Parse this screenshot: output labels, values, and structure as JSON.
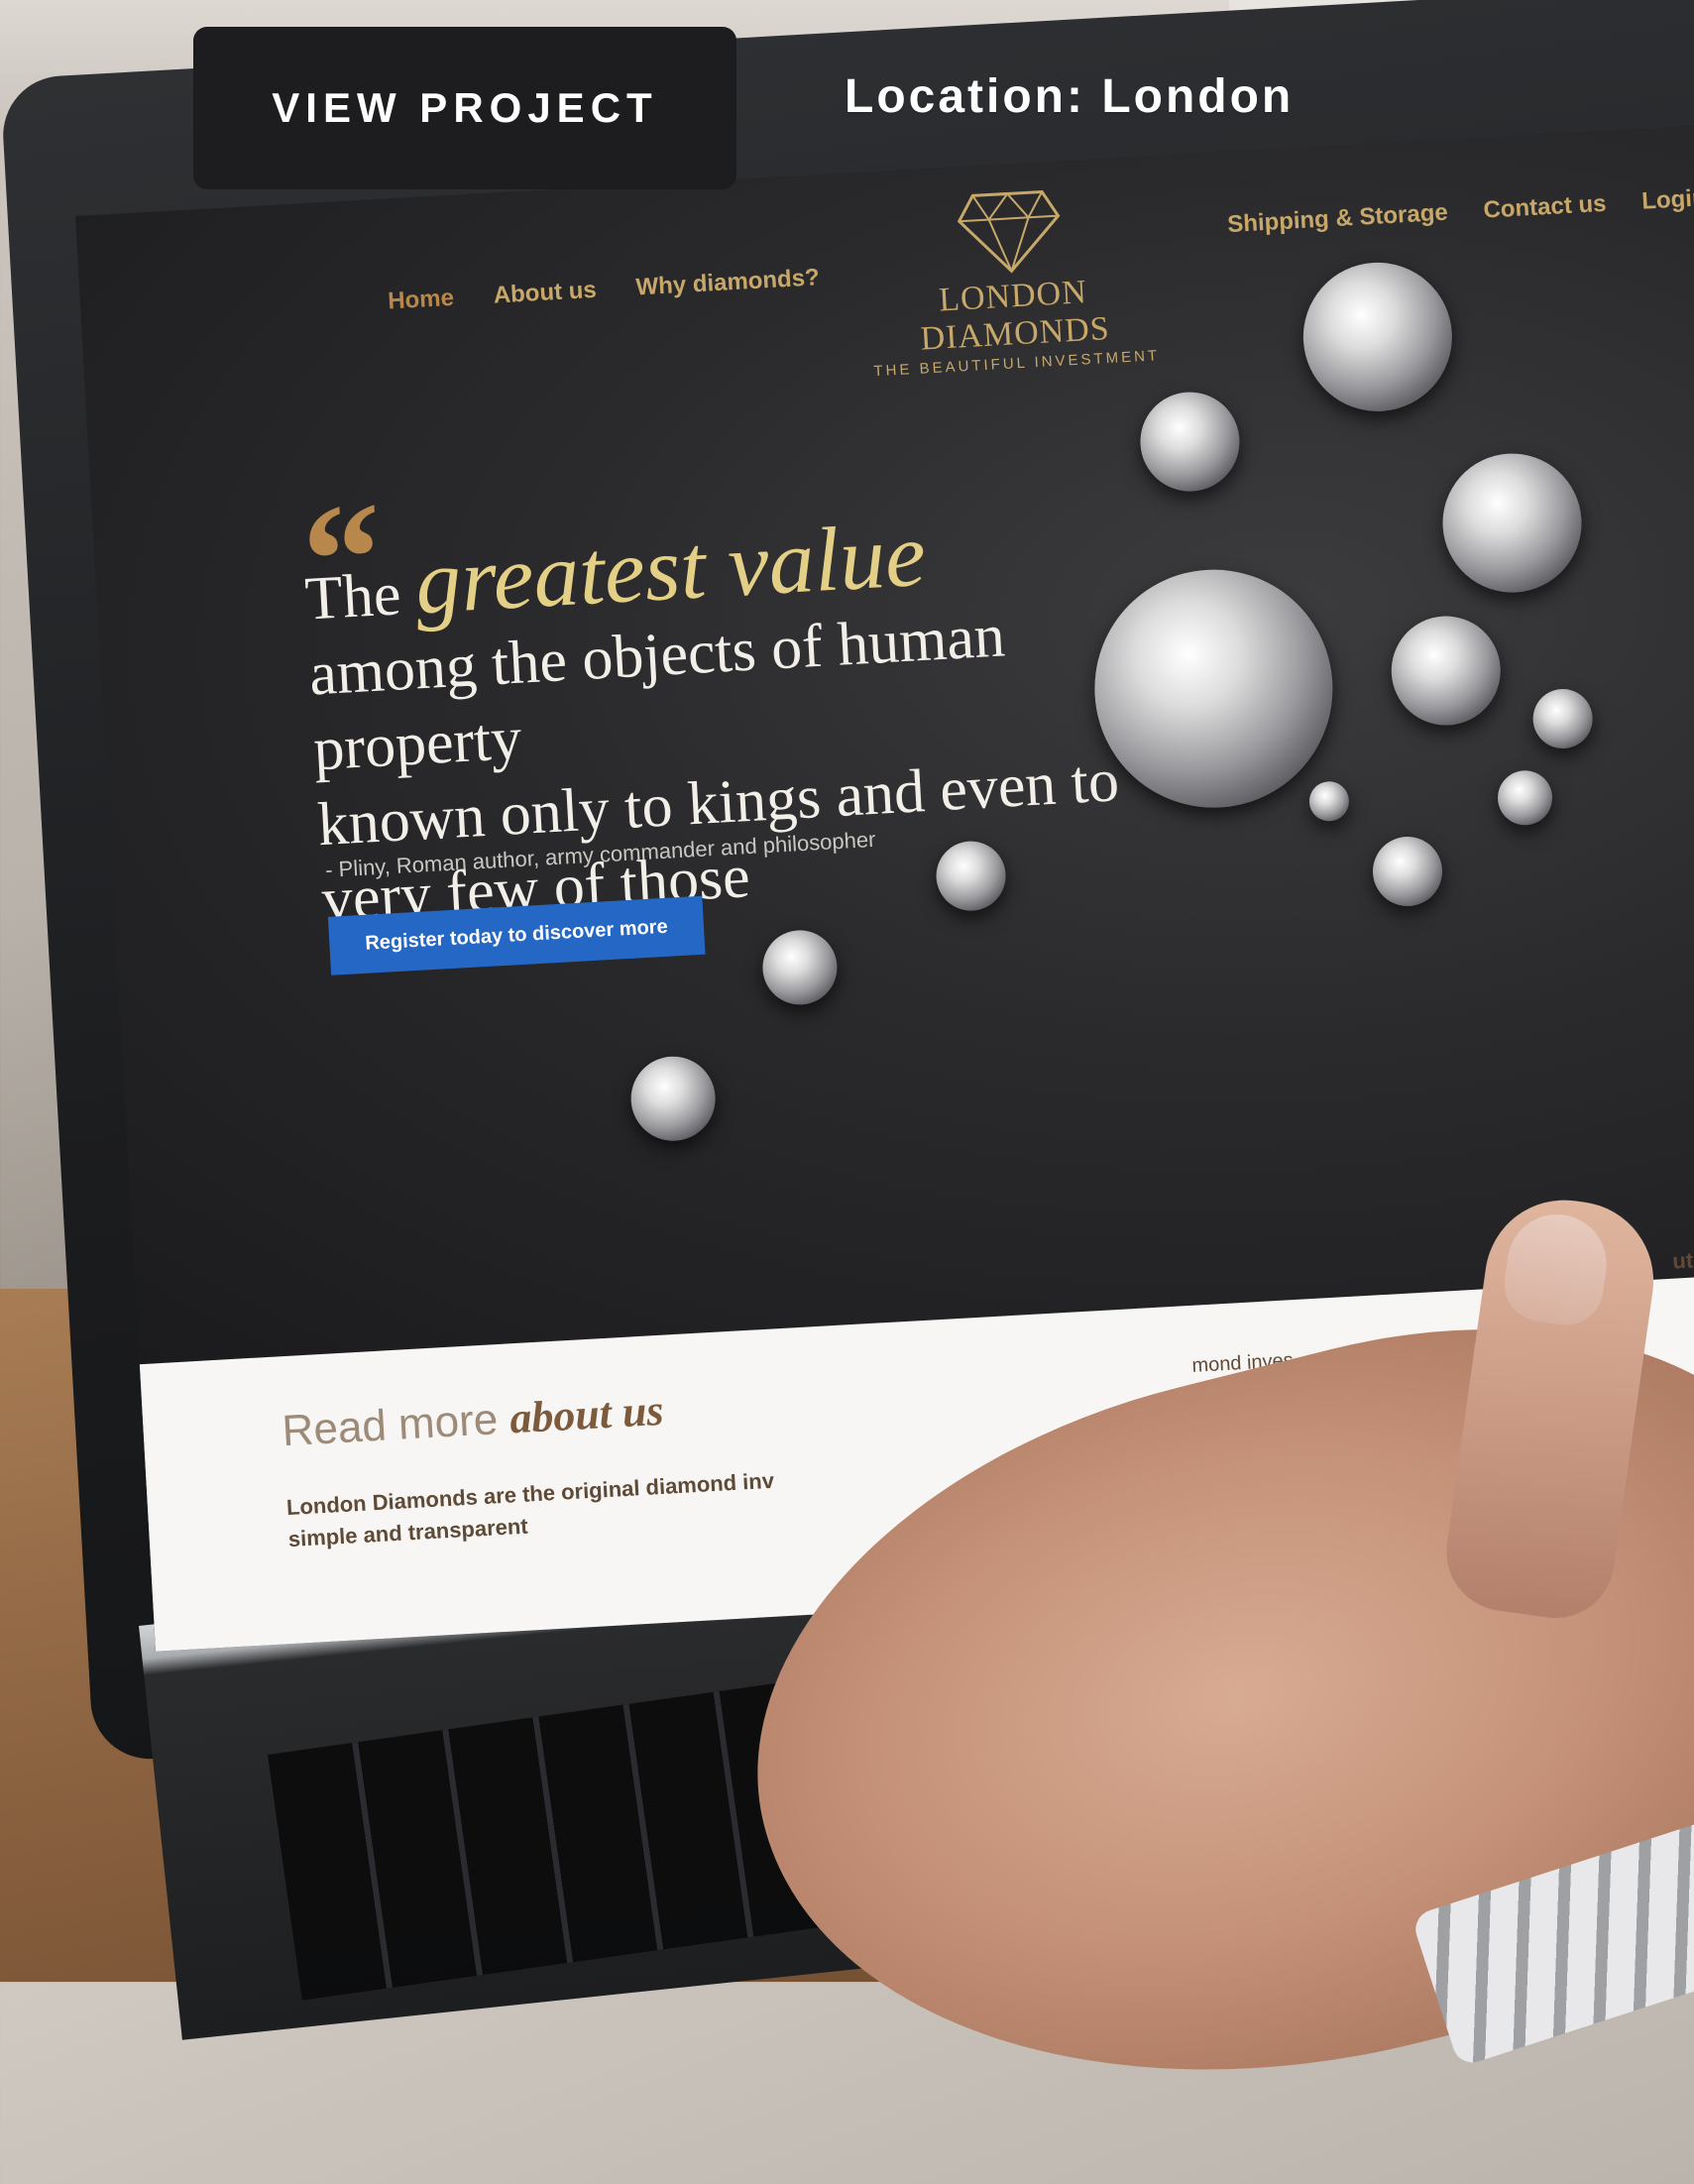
{
  "overlay": {
    "view_project_label": "VIEW PROJECT",
    "location_text": "Location: London"
  },
  "site": {
    "nav_left": [
      "Home",
      "About us",
      "Why diamonds?"
    ],
    "nav_right": [
      "Shipping & Storage",
      "Contact us",
      "Login"
    ],
    "logo_name": "LONDON DIAMONDS",
    "logo_tagline": "THE BEAUTIFUL INVESTMENT",
    "quote": {
      "lead": "The",
      "accent": "greatest value",
      "line2": "among the objects of human property",
      "line3": "known only to kings and even to",
      "line4": "very few of those",
      "attribution": "- Pliny, Roman author, army commander and philosopher"
    },
    "cta_label": "Register today to discover more",
    "about": {
      "heading_lead": "Read more",
      "heading_accent": "about us",
      "text_line1": "London Diamonds are the original diamond inv",
      "text_line2": "simple and transparent",
      "fragment": "mond inves",
      "fragment2": "ut get"
    }
  },
  "colors": {
    "overlay_button_bg": "#1d1c1e",
    "gold": "#c7a86a",
    "cta_blue": "#2467c5"
  }
}
